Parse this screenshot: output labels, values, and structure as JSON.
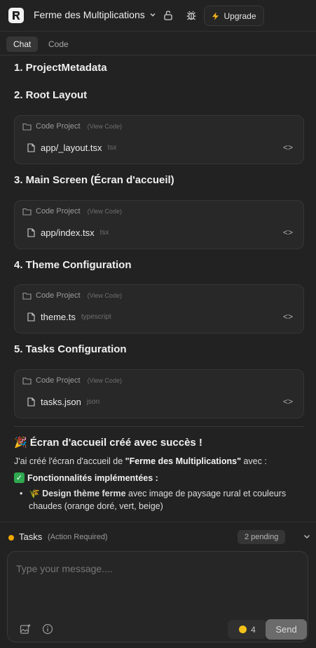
{
  "header": {
    "project_title": "Ferme des Multiplications",
    "upgrade_label": "Upgrade"
  },
  "tabs": [
    {
      "label": "Chat",
      "active": true
    },
    {
      "label": "Code",
      "active": false
    }
  ],
  "sections": [
    {
      "heading": "1. ProjectMetadata"
    },
    {
      "heading": "2. Root Layout",
      "card": {
        "title": "Code Project",
        "view": "(View Code)",
        "file": "app/_layout.tsx",
        "lang": "tsx"
      }
    },
    {
      "heading": "3. Main Screen (Écran d'accueil)",
      "card": {
        "title": "Code Project",
        "view": "(View Code)",
        "file": "app/index.tsx",
        "lang": "tsx"
      }
    },
    {
      "heading": "4. Theme Configuration",
      "card": {
        "title": "Code Project",
        "view": "(View Code)",
        "file": "theme.ts",
        "lang": "typescript"
      }
    },
    {
      "heading": "5. Tasks Configuration",
      "card": {
        "title": "Code Project",
        "view": "(View Code)",
        "file": "tasks.json",
        "lang": "json"
      }
    }
  ],
  "summary": {
    "emoji": "🎉",
    "title": "Écran d'accueil créé avec succès !",
    "intro_prefix": "J'ai créé l'écran d'accueil de ",
    "intro_bold": "\"Ferme des Multiplications\"",
    "intro_suffix": " avec :",
    "features_title": "Fonctionnalités implémentées :",
    "bullet_emoji": "🌾",
    "bullet_bold": "Design thème ferme",
    "bullet_text": " avec image de paysage rural et couleurs chaudes (orange doré, vert, beige)"
  },
  "tasks": {
    "label": "Tasks",
    "required": "(Action Required)",
    "pending": "2 pending"
  },
  "composer": {
    "placeholder": "Type your message....",
    "credits": "4",
    "send_label": "Send"
  },
  "colors": {
    "background": "#222222",
    "card": "#282828",
    "tasks_dot": "#f0a800",
    "check": "#2fa84f",
    "send": "#6b6b6b"
  }
}
